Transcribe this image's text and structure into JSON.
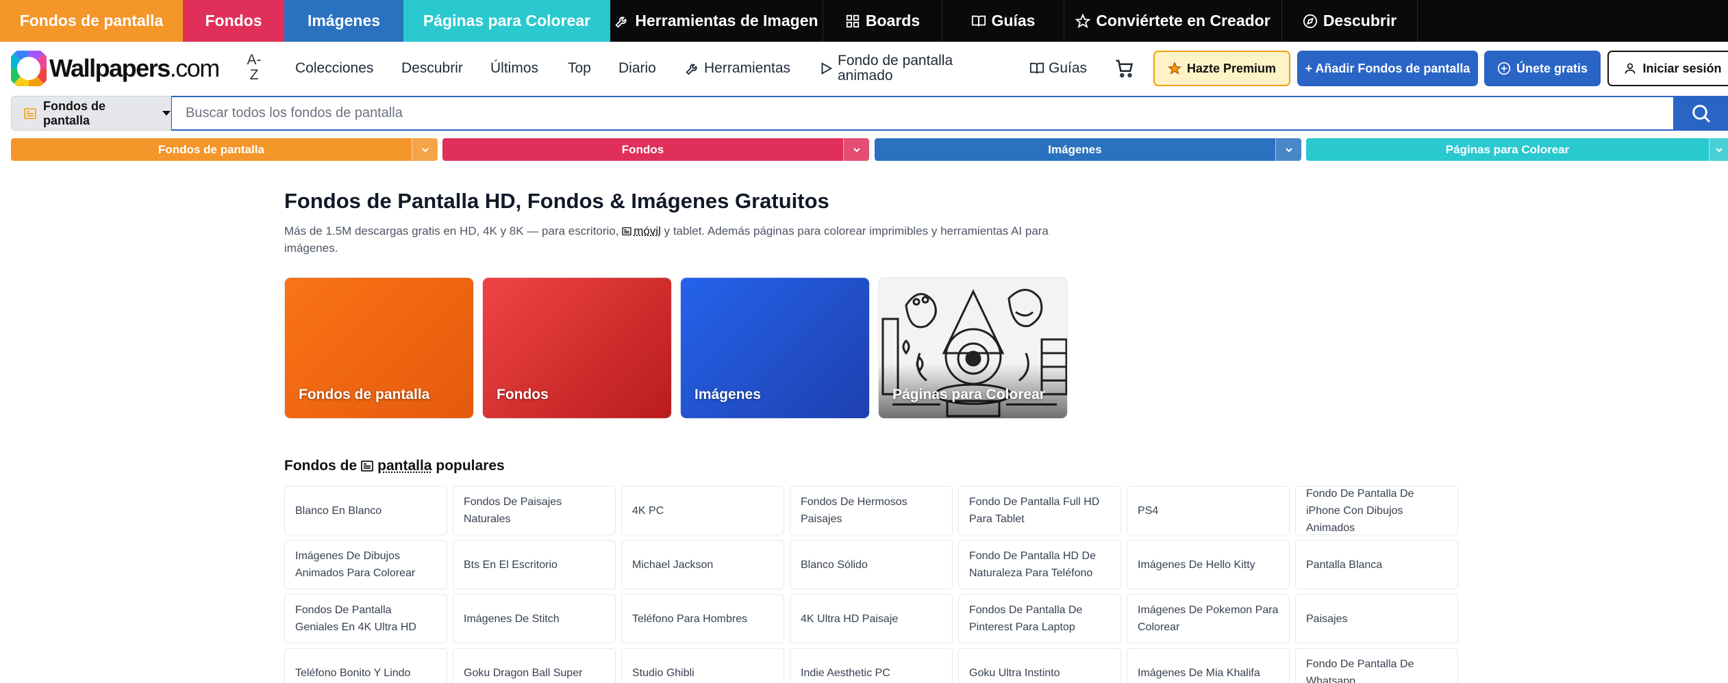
{
  "topnav": {
    "items": [
      {
        "label": "Fondos de pantalla",
        "color": "#f4962a"
      },
      {
        "label": "Fondos",
        "color": "#e0305a"
      },
      {
        "label": "Imágenes",
        "color": "#2a72c0"
      },
      {
        "label": "Páginas para Colorear",
        "color": "#2ac8cf"
      },
      {
        "label": "Herramientas de Imagen",
        "icon": "wrench-icon"
      },
      {
        "label": "Boards",
        "icon": "grid-icon"
      },
      {
        "label": "Guías",
        "icon": "book-icon"
      },
      {
        "label": "Conviértete en Creador",
        "icon": "star-icon"
      },
      {
        "label": "Descubrir",
        "icon": "compass-icon"
      }
    ]
  },
  "header": {
    "logo_name": "Wallpapers",
    "logo_tld": ".com",
    "az_top": "A-",
    "az_bottom": "Z",
    "nav": [
      "Colecciones",
      "Descubrir",
      "Últimos",
      "Top",
      "Diario"
    ],
    "tools_label": "Herramientas",
    "animated_label": "Fondo de pantalla animado",
    "guides_label": "Guías",
    "premium_label": "Hazte Premium",
    "add_label": "+ Añadir Fondos de pantalla",
    "join_label": "Únete gratis",
    "login_label": "Iniciar sesión"
  },
  "search": {
    "category": "Fondos de pantalla",
    "placeholder": "Buscar todos los fondos de pantalla"
  },
  "catbars": [
    {
      "label": "Fondos de pantalla",
      "color": "#f4962a"
    },
    {
      "label": "Fondos",
      "color": "#e0305a"
    },
    {
      "label": "Imágenes",
      "color": "#2a72c0"
    },
    {
      "label": "Páginas para Colorear",
      "color": "#2ac8cf"
    }
  ],
  "main": {
    "title": "Fondos de Pantalla HD, Fondos & Imágenes Gratuitos",
    "subtitle_a": "Más de 1.5M descargas gratis en HD, 4K y 8K — para escritorio, ",
    "subtitle_mobile": "móvil",
    "subtitle_b": " y tablet. Además páginas para colorear imprimibles y herramientas AI para imágenes.",
    "tiles": [
      "Fondos de pantalla",
      "Fondos",
      "Imágenes",
      "Páginas para Colorear"
    ]
  },
  "popular": {
    "title_a": "Fondos de",
    "title_b": "pantalla",
    "title_c": "populares",
    "items": [
      "Blanco En Blanco",
      "Fondos De Paisajes Naturales",
      "4K PC",
      "Fondos De Hermosos Paisajes",
      "Fondo De Pantalla Full HD Para Tablet",
      "PS4",
      "Fondo De Pantalla De iPhone Con Dibujos Animados",
      "Imágenes De Dibujos Animados Para Colorear",
      "Bts En El Escritorio",
      "Michael Jackson",
      "Blanco Sólido",
      "Fondo De Pantalla HD De Naturaleza Para Teléfono",
      "Imágenes De Hello Kitty",
      "Pantalla Blanca",
      "Fondos De Pantalla Geniales En 4K Ultra HD",
      "Imágenes De Stitch",
      "Teléfono Para Hombres",
      "4K Ultra HD Paisaje",
      "Fondos De Pantalla De Pinterest Para Laptop",
      "Imágenes De Pokemon Para Colorear",
      "Paisajes",
      "Teléfono Bonito Y Lindo",
      "Goku Dragon Ball Super",
      "Studio Ghibli",
      "Indie Aesthetic PC",
      "Goku Ultra Instinto",
      "Imágenes De Mia Khalifa",
      "Fondo De Pantalla De Whatsapp"
    ]
  }
}
